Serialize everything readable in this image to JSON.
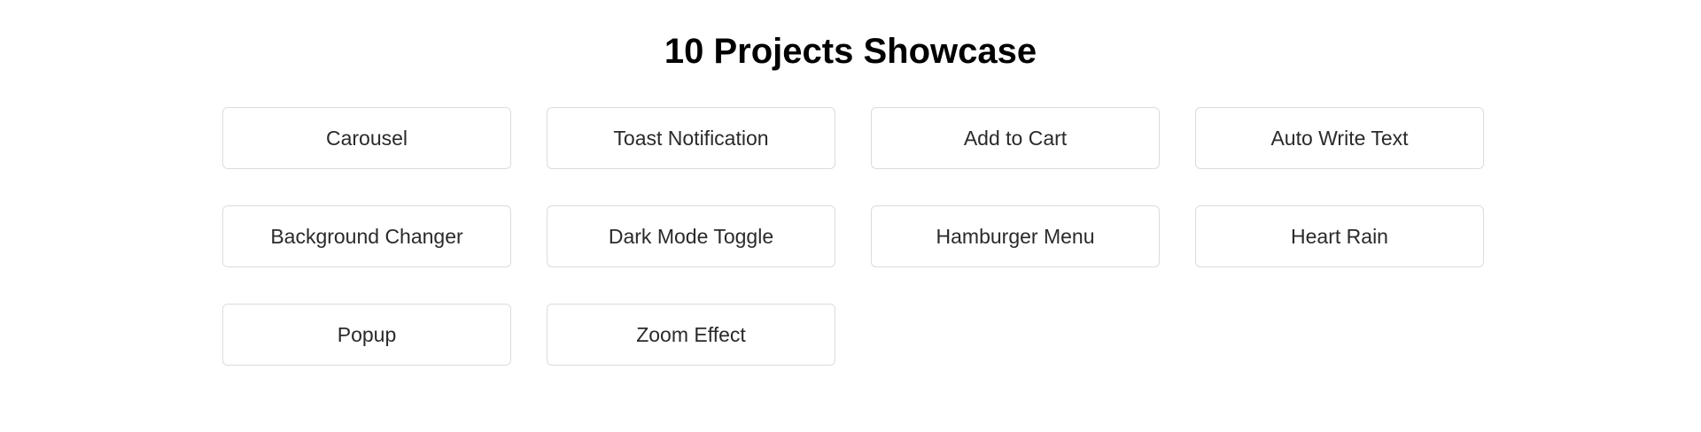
{
  "page": {
    "title": "10 Projects Showcase"
  },
  "projects": [
    {
      "label": "Carousel"
    },
    {
      "label": "Toast Notification"
    },
    {
      "label": "Add to Cart"
    },
    {
      "label": "Auto Write Text"
    },
    {
      "label": "Background Changer"
    },
    {
      "label": "Dark Mode Toggle"
    },
    {
      "label": "Hamburger Menu"
    },
    {
      "label": "Heart Rain"
    },
    {
      "label": "Popup"
    },
    {
      "label": "Zoom Effect"
    }
  ],
  "colors": {
    "background": "#ffffff",
    "title_text": "#000000",
    "card_text": "#2a2a2a",
    "card_border": "#dcdcdc"
  }
}
